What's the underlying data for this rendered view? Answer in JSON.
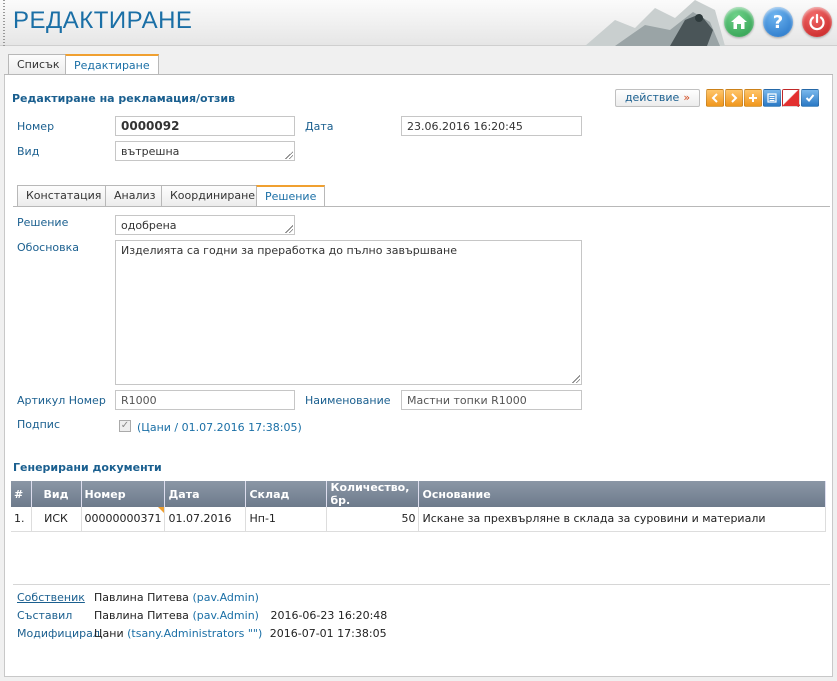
{
  "header": {
    "title": "РЕДАКТИРАНЕ",
    "buttons": [
      {
        "name": "home-icon"
      },
      {
        "name": "help-icon",
        "glyph": "?"
      },
      {
        "name": "power-icon"
      }
    ]
  },
  "main_tabs": [
    "Списък",
    "Редактиране"
  ],
  "form": {
    "title": "Редактиране на рекламация/отзив",
    "action_label": "действие",
    "action_chev": "»",
    "number_label": "Номер",
    "number_value": "0000092",
    "date_label": "Дата",
    "date_value": "23.06.2016 16:20:45",
    "kind_label": "Вид",
    "kind_value": "вътрешна"
  },
  "sub_tabs": [
    "Констатация",
    "Анализ",
    "Координиране",
    "Решение"
  ],
  "decision": {
    "decision_label": "Решение",
    "decision_value": "одобрена",
    "reason_label": "Обосновка",
    "reason_value": "Изделията са годни за преработка до пълно завършване",
    "article_label": "Артикул Номер",
    "article_value": "R1000",
    "name_label": "Наименование",
    "name_value": "Мастни топки R1000",
    "signature_label": "Подпис",
    "signature_value": "(Цани / 01.07.2016 17:38:05)"
  },
  "generated_docs": {
    "title": "Генерирани документи",
    "columns": [
      "#",
      "Вид",
      "Номер",
      "Дата",
      "Склад",
      "Количество, бр.",
      "Основание"
    ],
    "rows": [
      [
        "1.",
        "ИСК",
        "00000000371",
        "01.07.2016",
        "Нп-1",
        "50",
        "Искане за прехвърляне в склада за суровини и материали"
      ]
    ]
  },
  "meta": {
    "owner_label": "Собственик",
    "owner_name": "Павлина Питева",
    "owner_user": "(pav.Admin)",
    "author_label": "Съставил",
    "author_name": "Павлина Питева",
    "author_user": "(pav.Admin)",
    "author_time": "2016-06-23 16:20:48",
    "modifier_label": "Модифицирал",
    "modifier_name": "Цани",
    "modifier_user": "(tsany.Administrators \"\")",
    "modifier_time": "2016-07-01 17:38:05"
  },
  "colors": {
    "accent": "#1a6fa6",
    "tab_highlight": "#f0a030",
    "table_header": "#7a8696"
  }
}
